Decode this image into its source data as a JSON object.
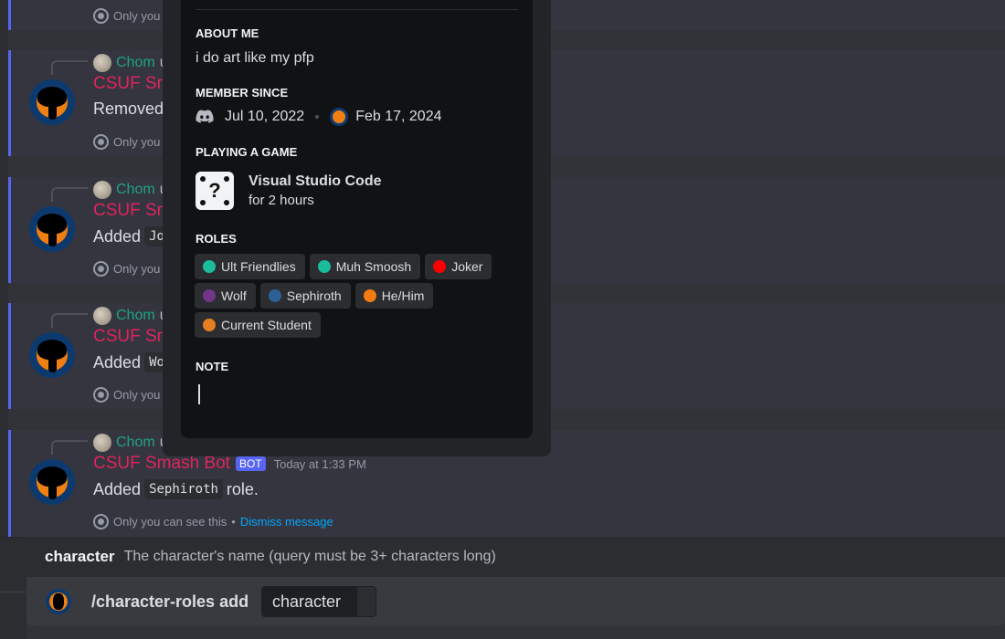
{
  "messages": [
    {
      "reply_user": "",
      "author": "",
      "content": "",
      "ephemeral": "Only you can see this"
    },
    {
      "reply_user": "Chom",
      "reply_rest": "u",
      "author": "CSUF Smash Bot",
      "content": "Removed",
      "code": "",
      "ephemeral": "Only you can see this"
    },
    {
      "reply_user": "Chom",
      "reply_rest": "u",
      "author": "CSUF Smash Bot",
      "content": "Added",
      "code": "Jo",
      "ephemeral": "Only you can see this"
    },
    {
      "reply_user": "Chom",
      "reply_rest": "u",
      "author": "CSUF Smash Bot",
      "content": "Added",
      "code": "Wo",
      "ephemeral": "Only you can see this"
    },
    {
      "reply_user": "Chom",
      "reply_rest": "u",
      "author": "CSUF Smash Bot",
      "badge": "BOT",
      "time": "Today at 1:33 PM",
      "content": "Added",
      "code": "Sephiroth",
      "after": "role.",
      "ephemeral": "Only you can see this",
      "sep": "•",
      "dismiss": "Dismiss message"
    }
  ],
  "profile": {
    "about_label": "ABOUT ME",
    "about": "i do art like my pfp",
    "member_label": "MEMBER SINCE",
    "discord_date": "Jul 10, 2022",
    "server_date": "Feb 17, 2024",
    "game_label": "PLAYING A GAME",
    "game_name": "Visual Studio Code",
    "game_time": "for 2 hours",
    "roles_label": "ROLES",
    "roles": [
      {
        "name": "Ult Friendlies",
        "color": "#1abc9c"
      },
      {
        "name": "Muh Smoosh",
        "color": "#1abc9c"
      },
      {
        "name": "Joker",
        "color": "#ff0000"
      },
      {
        "name": "Wolf",
        "color": "#71368a"
      },
      {
        "name": "Sephiroth",
        "color": "#2e6095"
      },
      {
        "name": "He/Him",
        "color": "#f47b0f"
      },
      {
        "name": "Current Student",
        "color": "#e67e22"
      }
    ],
    "note_label": "NOTE",
    "note_value": ""
  },
  "autocomplete": {
    "option": "character",
    "description": "The character's name (query must be 3+ characters long)"
  },
  "composer": {
    "command": "/character-roles add",
    "option_value": "character"
  },
  "colors": {
    "accent": "#5865f2",
    "bot_name": "#e0245e",
    "link": "#00a8fc"
  }
}
